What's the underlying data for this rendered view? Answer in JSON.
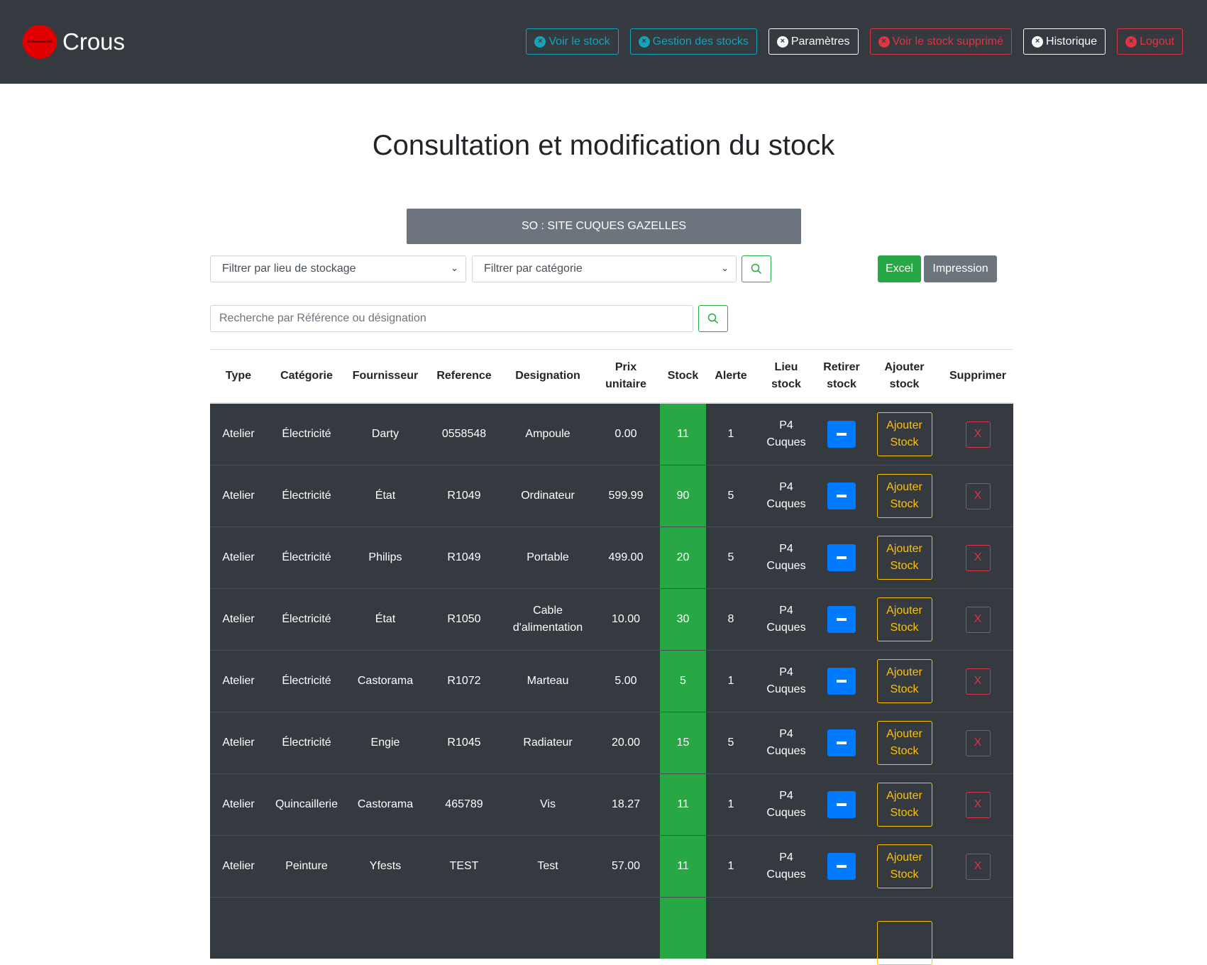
{
  "navbar": {
    "brand": "Crous",
    "buttons": [
      {
        "label": "Voir le stock",
        "style": "info"
      },
      {
        "label": "Gestion des stocks",
        "style": "info"
      },
      {
        "label": "Paramètres",
        "style": "light"
      },
      {
        "label": "Voir le stock supprimé",
        "style": "danger"
      },
      {
        "label": "Historique",
        "style": "light"
      },
      {
        "label": "Logout",
        "style": "danger"
      }
    ]
  },
  "page": {
    "title": "Consultation et modification du stock",
    "site": "SO : SITE CUQUES GAZELLES"
  },
  "filters": {
    "location_placeholder": "Filtrer par lieu de stockage",
    "category_placeholder": "Filtrer par catégorie",
    "excel_label": "Excel",
    "print_label": "Impression",
    "search_placeholder": "Recherche par Référence ou désignation"
  },
  "table": {
    "headers": [
      "Type",
      "Catégorie",
      "Fournisseur",
      "Reference",
      "Designation",
      "Prix unitaire",
      "Stock",
      "Alerte",
      "Lieu stock",
      "Retirer stock",
      "Ajouter stock",
      "Supprimer"
    ],
    "add_label": "Ajouter Stock",
    "delete_label": "X",
    "rows": [
      {
        "type": "Atelier",
        "categorie": "Électricité",
        "fournisseur": "Darty",
        "reference": "0558548",
        "designation": "Ampoule",
        "prix": "0.00",
        "stock": "11",
        "alerte": "1",
        "lieu": "P4 Cuques"
      },
      {
        "type": "Atelier",
        "categorie": "Électricité",
        "fournisseur": "État",
        "reference": "R1049",
        "designation": "Ordinateur",
        "prix": "599.99",
        "stock": "90",
        "alerte": "5",
        "lieu": "P4 Cuques"
      },
      {
        "type": "Atelier",
        "categorie": "Électricité",
        "fournisseur": "Philips",
        "reference": "R1049",
        "designation": "Portable",
        "prix": "499.00",
        "stock": "20",
        "alerte": "5",
        "lieu": "P4 Cuques"
      },
      {
        "type": "Atelier",
        "categorie": "Électricité",
        "fournisseur": "État",
        "reference": "R1050",
        "designation": "Cable d'alimentation",
        "prix": "10.00",
        "stock": "30",
        "alerte": "8",
        "lieu": "P4 Cuques"
      },
      {
        "type": "Atelier",
        "categorie": "Électricité",
        "fournisseur": "Castorama",
        "reference": "R1072",
        "designation": "Marteau",
        "prix": "5.00",
        "stock": "5",
        "alerte": "1",
        "lieu": "P4 Cuques"
      },
      {
        "type": "Atelier",
        "categorie": "Électricité",
        "fournisseur": "Engie",
        "reference": "R1045",
        "designation": "Radiateur",
        "prix": "20.00",
        "stock": "15",
        "alerte": "5",
        "lieu": "P4 Cuques"
      },
      {
        "type": "Atelier",
        "categorie": "Quincaillerie",
        "fournisseur": "Castorama",
        "reference": "465789",
        "designation": "Vis",
        "prix": "18.27",
        "stock": "11",
        "alerte": "1",
        "lieu": "P4 Cuques"
      },
      {
        "type": "Atelier",
        "categorie": "Peinture",
        "fournisseur": "Yfests",
        "reference": "TEST",
        "designation": "Test",
        "prix": "57.00",
        "stock": "11",
        "alerte": "1",
        "lieu": "P4 Cuques"
      },
      {
        "type": "",
        "categorie": "",
        "fournisseur": "",
        "reference": "",
        "designation": "",
        "prix": "",
        "stock": "",
        "alerte": "",
        "lieu": ""
      }
    ]
  },
  "colors": {
    "navbar_bg": "#343a40",
    "info": "#17a2b8",
    "danger": "#dc3545",
    "success": "#28a745",
    "warning": "#ffc107",
    "primary": "#007bff",
    "secondary": "#6c757d"
  }
}
